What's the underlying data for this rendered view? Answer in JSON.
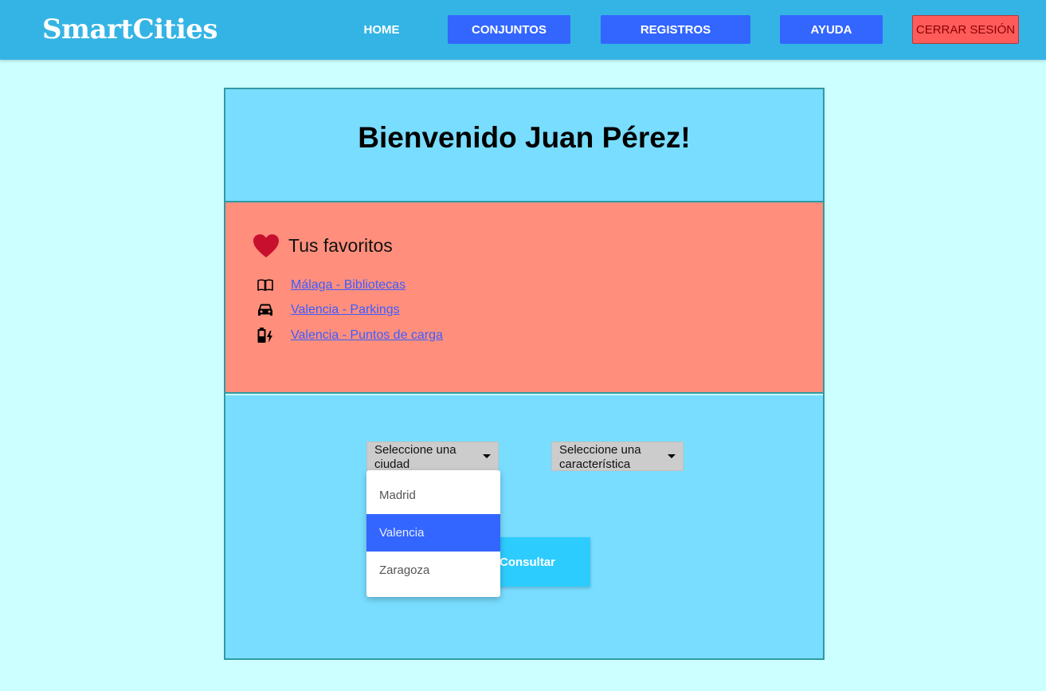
{
  "navbar": {
    "brand": "SmartCities",
    "home": "HOME",
    "conjuntos": "CONJUNTOS",
    "registros": "REGISTROS",
    "ayuda": "AYUDA",
    "logout": "CERRAR SESIÓN",
    "colors": {
      "bar": "#34b4e4",
      "button": "#3366ff",
      "logout": "#ff5b5b"
    }
  },
  "welcome": {
    "title": "Bienvenido Juan Pérez!"
  },
  "favorites": {
    "title": "Tus favoritos",
    "icon": "heart-icon",
    "items": [
      {
        "icon": "book-icon",
        "label": "Málaga - Bibliotecas"
      },
      {
        "icon": "car-icon",
        "label": "Valencia - Parkings"
      },
      {
        "icon": "charging-icon",
        "label": "Valencia - Puntos de carga"
      }
    ]
  },
  "query": {
    "city_select": "Seleccione una ciudad",
    "feature_select": "Seleccione una característica",
    "submit": "Consultar",
    "city_options": [
      "Madrid",
      "Valencia",
      "Zaragoza"
    ],
    "highlighted_option": "Valencia"
  }
}
